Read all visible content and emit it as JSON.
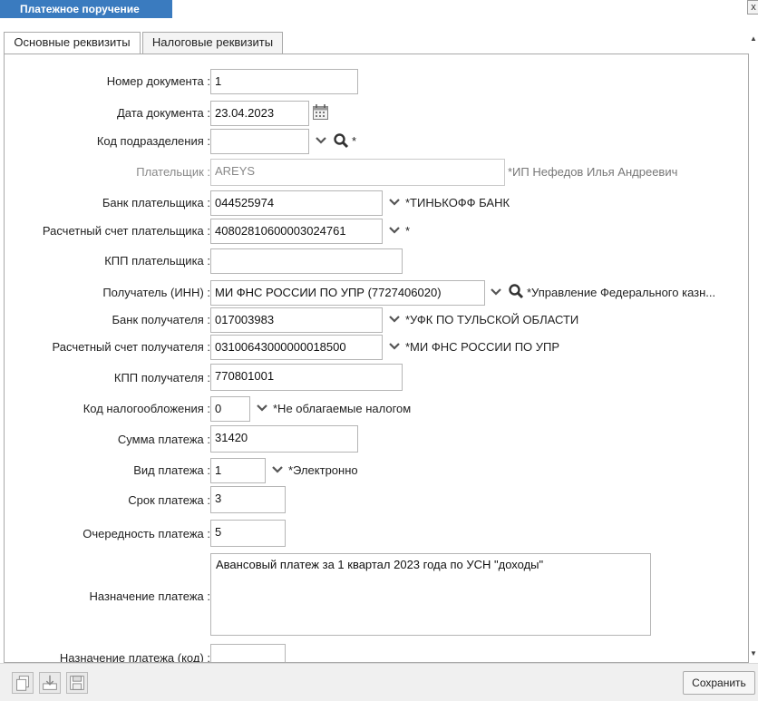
{
  "window": {
    "title": "Платежное поручение",
    "close_label": "x"
  },
  "tabs": [
    {
      "label": "Основные реквизиты"
    },
    {
      "label": "Налоговые реквизиты"
    }
  ],
  "form": {
    "doc_number": {
      "label": "Номер документа :",
      "value": "1"
    },
    "doc_date": {
      "label": "Дата документа :",
      "value": "23.04.2023"
    },
    "division_code": {
      "label": "Код подразделения :",
      "value": "",
      "note": "*"
    },
    "payer": {
      "label": "Плательщик :",
      "value": "AREYS",
      "note": "*ИП Нефедов Илья Андреевич"
    },
    "payer_bank": {
      "label": "Банк плательщика :",
      "value": "044525974",
      "note": "*ТИНЬКОФФ БАНК"
    },
    "payer_account": {
      "label": "Расчетный счет плательщика :",
      "value": "40802810600003024761",
      "note": "*"
    },
    "payer_kpp": {
      "label": "КПП плательщика :",
      "value": ""
    },
    "recipient": {
      "label": "Получатель (ИНН) :",
      "value": "МИ ФНС РОССИИ ПО УПР (7727406020)",
      "note": "*Управление Федерального казн..."
    },
    "recipient_bank": {
      "label": "Банк получателя :",
      "value": "017003983",
      "note": "*УФК ПО ТУЛЬСКОЙ ОБЛАСТИ"
    },
    "recipient_account": {
      "label": "Расчетный счет получателя :",
      "value": "03100643000000018500",
      "note": "*МИ ФНС РОССИИ ПО УПР"
    },
    "recipient_kpp": {
      "label": "КПП получателя :",
      "value": "770801001"
    },
    "tax_code": {
      "label": "Код налогообложения :",
      "value": "0",
      "note": "*Не облагаемые налогом"
    },
    "amount": {
      "label": "Сумма платежа :",
      "value": "31420"
    },
    "payment_type": {
      "label": "Вид платежа :",
      "value": "1",
      "note": "*Электронно"
    },
    "payment_term": {
      "label": "Срок платежа :",
      "value": "3"
    },
    "priority": {
      "label": "Очередность платежа :",
      "value": "5"
    },
    "purpose": {
      "label": "Назначение платежа :",
      "value": "Авансовый платеж за 1 квартал 2023 года по УСН  \"доходы\""
    },
    "purpose_code": {
      "label": "Назначение платежа (код) :",
      "value": ""
    }
  },
  "footer": {
    "icons": [
      "copy-icon",
      "download-icon",
      "save-disk-icon"
    ],
    "save_label": "Сохранить"
  },
  "colors": {
    "title_bg": "#3a7bbf",
    "border": "#b5b5b5"
  }
}
